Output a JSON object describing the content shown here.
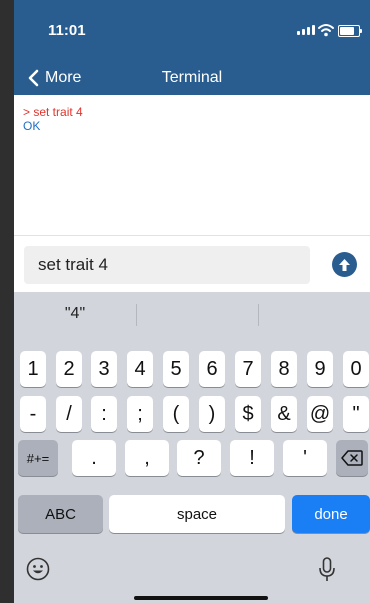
{
  "status_bar": {
    "time": "11:01"
  },
  "nav": {
    "back_label": "More",
    "title": "Terminal"
  },
  "terminal": {
    "command_line": "> set trait 4",
    "response_line": "OK"
  },
  "input": {
    "value": "set trait 4"
  },
  "keyboard": {
    "suggestions": [
      "\"4\"",
      "",
      ""
    ],
    "row1": [
      "1",
      "2",
      "3",
      "4",
      "5",
      "6",
      "7",
      "8",
      "9",
      "0"
    ],
    "row2": [
      "-",
      "/",
      ":",
      ";",
      "(",
      ")",
      "$",
      "&",
      "@",
      "\""
    ],
    "row3": {
      "mode": "#+=",
      "keys": [
        ".",
        ",",
        "?",
        "!",
        "'"
      ]
    },
    "row4": {
      "abc": "ABC",
      "space": "space",
      "done": "done"
    }
  }
}
